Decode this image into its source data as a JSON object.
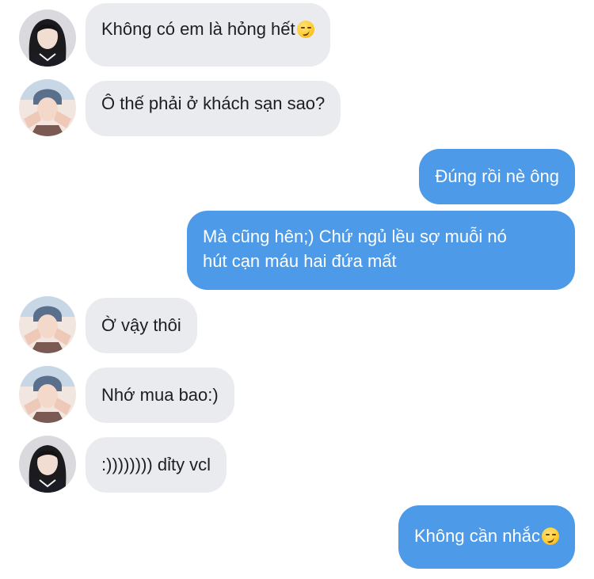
{
  "conversation": {
    "messages": [
      {
        "sender": "her",
        "direction": "incoming",
        "text": "Không có em là hỏng hết",
        "emoji": "smirking-face"
      },
      {
        "sender": "him",
        "direction": "incoming",
        "text": "Ô thế phải ở khách sạn sao?"
      },
      {
        "sender": "me",
        "direction": "outgoing",
        "text": "Đúng rồi nè ông"
      },
      {
        "sender": "me",
        "direction": "outgoing",
        "line1": "Mà cũng hên;) Chứ ngủ lều sợ muỗi nó",
        "line2": "hút cạn máu hai đứa mất"
      },
      {
        "sender": "him",
        "direction": "incoming",
        "text": "Ờ vậy thôi"
      },
      {
        "sender": "him",
        "direction": "incoming",
        "text": "Nhớ mua bao:)"
      },
      {
        "sender": "her",
        "direction": "incoming",
        "text": ":)))))))) dỉty vcl"
      },
      {
        "sender": "me",
        "direction": "outgoing",
        "text": "Không cần nhắc",
        "emoji": "smirking-face"
      }
    ]
  },
  "colors": {
    "incoming_bubble": "#e9ebee",
    "outgoing_bubble": "#4c9ae8",
    "incoming_text": "#1c1e21",
    "outgoing_text": "#ffffff"
  }
}
